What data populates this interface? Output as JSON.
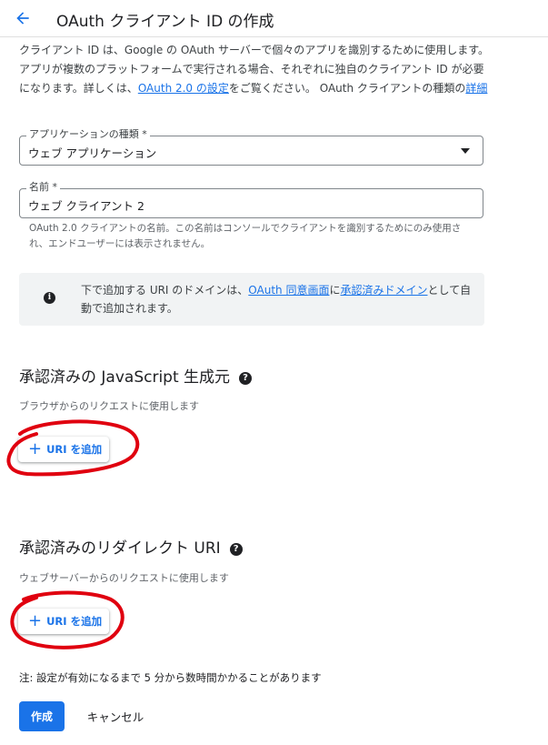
{
  "header": {
    "title": "OAuth クライアント ID の作成"
  },
  "intro": {
    "text_before_link": "クライアント ID は、Google の OAuth サーバーで個々のアプリを識別するために使用します。アプリが複数のプラットフォームで実行される場合、それぞれに独自のクライアント ID が必要になります。詳しくは、",
    "settings_link": "OAuth 2.0 の設定",
    "text_middle": "をご覧ください。 OAuth クライアントの種類の",
    "details_link": "詳細"
  },
  "app_type": {
    "label": "アプリケーションの種類 *",
    "value": "ウェブ アプリケーション"
  },
  "name_field": {
    "label": "名前 *",
    "value": "ウェブ クライアント 2",
    "helper": "OAuth 2.0 クライアントの名前。この名前はコンソールでクライアントを識別するためにのみ使用され、エンドユーザーには表示されません。"
  },
  "info": {
    "icon": "info-icon",
    "text_before": "下で追加する URI のドメインは、",
    "consent_link": "OAuth 同意画面",
    "text_middle": "に",
    "domains_link": "承認済みドメイン",
    "text_after": "として自動で追加されます。"
  },
  "js_origins": {
    "title": "承認済みの JavaScript 生成元",
    "description": "ブラウザからのリクエストに使用します",
    "add_button": "URI を追加"
  },
  "redirect_uris": {
    "title": "承認済みのリダイレクト URI",
    "description": "ウェブサーバーからのリクエストに使用します",
    "add_button": "URI を追加"
  },
  "note": "注: 設定が有効になるまで 5 分から数時間かかることがあります",
  "actions": {
    "create": "作成",
    "cancel": "キャンセル"
  },
  "colors": {
    "accent": "#1a73e8",
    "annotation": "#e0000f",
    "info_background": "#f1f3f4"
  }
}
